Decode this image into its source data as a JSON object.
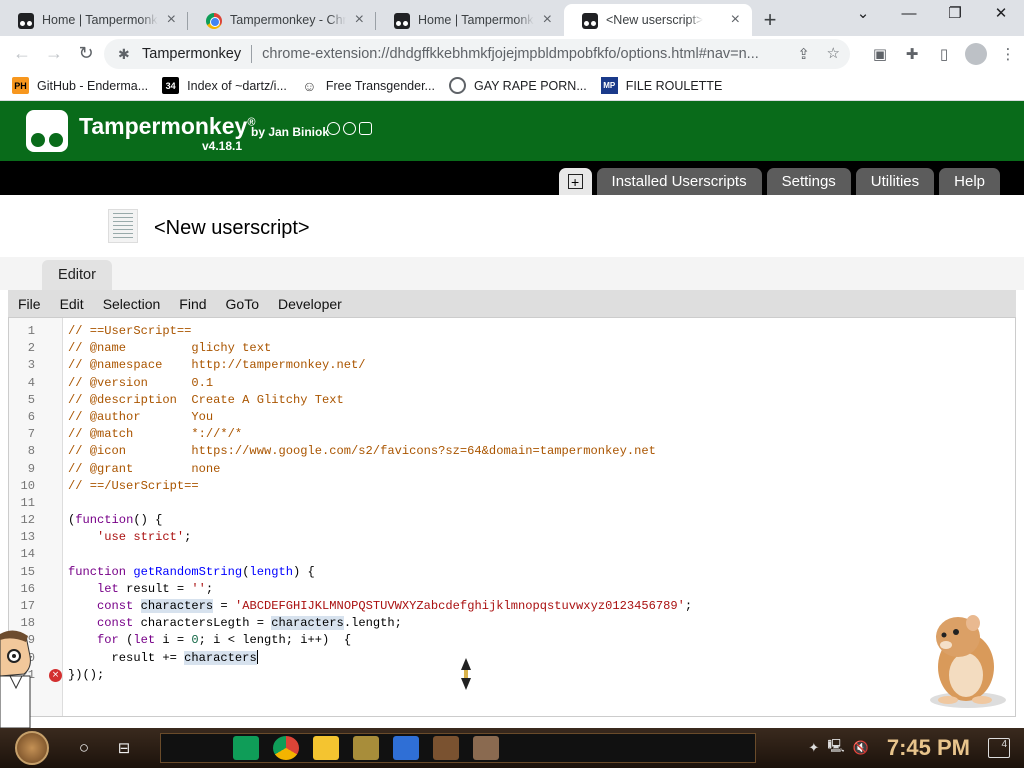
{
  "browser": {
    "tabs": [
      {
        "title": "Home | Tampermonkey",
        "icon": "tampermonkey-icon",
        "active": false
      },
      {
        "title": "Tampermonkey - Chrome Web Store",
        "icon": "chrome-store-icon",
        "active": false
      },
      {
        "title": "Home | Tampermonkey",
        "icon": "tampermonkey-icon",
        "active": false
      },
      {
        "title": "<New userscript>",
        "icon": "tampermonkey-icon",
        "active": true
      }
    ],
    "new_tab": "+",
    "window_controls": {
      "dropdown": "⌄",
      "minimize": "—",
      "restore": "❐",
      "close": "✕"
    },
    "omnibox": {
      "site": "Tampermonkey",
      "url": "chrome-extension://dhdgffkkebhmkfjojejmpbldmpobfkfo/options.html#nav=n..."
    },
    "bookmarks": [
      {
        "label": "GitHub - Enderma...",
        "icon": "ph-icon",
        "badge": "PH"
      },
      {
        "label": "Index of ~dartz/i...",
        "icon": "archive-icon",
        "badge": "34"
      },
      {
        "label": "Free Transgender...",
        "icon": "mask-icon",
        "badge": "☺"
      },
      {
        "label": "GAY RAPE PORN...",
        "icon": "globe-icon",
        "badge": ""
      },
      {
        "label": "FILE ROULETTE",
        "icon": "mp-icon",
        "badge": "MP"
      }
    ]
  },
  "tampermonkey": {
    "name": "Tampermonkey",
    "registered": "®",
    "by": "by Jan Biniok",
    "version": "v4.18.1",
    "nav": [
      "Installed Userscripts",
      "Settings",
      "Utilities",
      "Help"
    ],
    "add_tab_glyph": "+",
    "script_title": "<New userscript>",
    "editor_tab": "Editor",
    "menu": [
      "File",
      "Edit",
      "Selection",
      "Find",
      "GoTo",
      "Developer"
    ]
  },
  "code_lines": [
    "// ==UserScript==",
    "// @name         glichy text",
    "// @namespace    http://tampermonkey.net/",
    "// @version      0.1",
    "// @description  Create A Glitchy Text",
    "// @author       You",
    "// @match        *://*/*",
    "// @icon         https://www.google.com/s2/favicons?sz=64&domain=tampermonkey.net",
    "// @grant        none",
    "// ==/UserScript==",
    "",
    "(function() {",
    "    'use strict';",
    "",
    "function getRandomString(length) {",
    "    let result = '';",
    "    const characters = 'ABCDEFGHIJKLMNOPQSTUVWXYZabcdefghijklmnopqstuvwxyz0123456789';",
    "    const charactersLegth = characters.length;",
    "    for (let i = 0; i < length; i++)  {",
    "      result += characters",
    "})();"
  ],
  "error_line": 21,
  "taskbar": {
    "clock": "7:45 PM",
    "notifications": "4"
  }
}
